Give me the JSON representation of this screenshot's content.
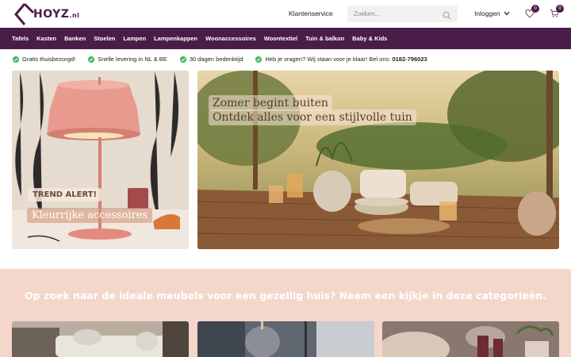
{
  "header": {
    "logo_text": "HOYZ",
    "logo_suffix": ".nl",
    "service_label": "Klantenservice",
    "search_placeholder": "Zoeken...",
    "login_label": "Inloggen",
    "wishlist_count": "0",
    "cart_count": "0"
  },
  "nav": {
    "items": [
      "Tafels",
      "Kasten",
      "Banken",
      "Stoelen",
      "Lampen",
      "Lampenkappen",
      "Woonaccessoires",
      "Woontextiel",
      "Tuin & balkon",
      "Baby & Kids"
    ]
  },
  "usps": {
    "items": [
      "Gratis thuisbezorgd!",
      "Snelle levering in NL & BE",
      "30 dagen bedenktijd"
    ],
    "contact_text": "Heb je vragen? Wij staan voor je klaar! Bel ons: ",
    "contact_phone": "0182-796023"
  },
  "banners": {
    "left": {
      "badge": "TREND ALERT!",
      "caption": "Kleurrijke accessoires"
    },
    "right": {
      "line1": "Zomer begint buiten",
      "line2": "Ontdek alles voor een stijlvolle tuin"
    }
  },
  "categories": {
    "title": "Op zoek naar de ideale meubels voor een gezellig huis? Neem een kijkje in deze categorieën."
  },
  "colors": {
    "brand": "#4a1d48",
    "check": "#3fb45f",
    "section_bg": "#f4d6cb"
  }
}
